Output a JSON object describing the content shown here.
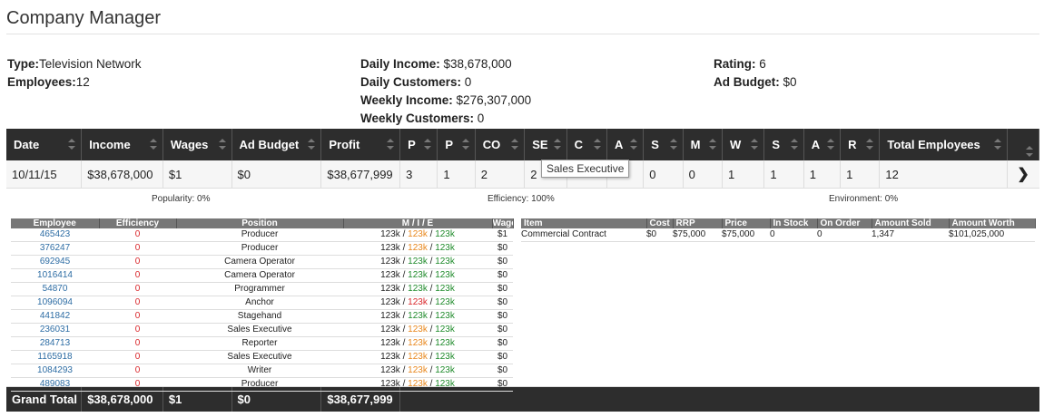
{
  "title": "Company Manager",
  "info": {
    "type_label": "Type:",
    "type_value": "Television Network",
    "employees_label": "Employees:",
    "employees_value": "12",
    "daily_income_label": "Daily Income:",
    "daily_income_value": " $38,678,000",
    "daily_customers_label": "Daily Customers:",
    "daily_customers_value": " 0",
    "weekly_income_label": "Weekly Income:",
    "weekly_income_value": " $276,307,000",
    "weekly_customers_label": "Weekly Customers:",
    "weekly_customers_value": " 0",
    "rating_label": "Rating:",
    "rating_value": " 6",
    "ad_budget_label": "Ad Budget:",
    "ad_budget_value": " $0"
  },
  "columns": [
    "Date",
    "Income",
    "Wages",
    "Ad Budget",
    "Profit",
    "P",
    "P",
    "CO",
    "SE",
    "C",
    "A",
    "S",
    "M",
    "W",
    "S",
    "A",
    "R",
    "Total Employees"
  ],
  "row": [
    "10/11/15",
    "$38,678,000",
    "$1",
    "$0",
    "$38,677,999",
    "3",
    "1",
    "2",
    "2",
    "",
    "",
    "0",
    "0",
    "1",
    "1",
    "1",
    "1",
    "12"
  ],
  "expand_icon": "chevron-right-icon",
  "tooltip": "Sales Executive",
  "metrics": {
    "popularity": "Popularity: 0%",
    "efficiency": "Efficiency: 100%",
    "environment": "Environment: 0%"
  },
  "employee_headers": [
    "Employee",
    "Efficiency",
    "Position",
    "M / I / E",
    "Wage"
  ],
  "employees": [
    {
      "id": "465423",
      "eff": "0",
      "pos": "Producer",
      "m": "123k",
      "i": "123k",
      "e": "123k",
      "i_color": "orange",
      "wage": "$1"
    },
    {
      "id": "376247",
      "eff": "0",
      "pos": "Producer",
      "m": "123k",
      "i": "123k",
      "e": "123k",
      "i_color": "orange",
      "wage": "$0"
    },
    {
      "id": "692945",
      "eff": "0",
      "pos": "Camera Operator",
      "m": "123k",
      "i": "123k",
      "e": "123k",
      "i_color": "green",
      "wage": "$0"
    },
    {
      "id": "1016414",
      "eff": "0",
      "pos": "Camera Operator",
      "m": "123k",
      "i": "123k",
      "e": "123k",
      "i_color": "green",
      "wage": "$0"
    },
    {
      "id": "54870",
      "eff": "0",
      "pos": "Programmer",
      "m": "123k",
      "i": "123k",
      "e": "123k",
      "i_color": "green",
      "wage": "$0"
    },
    {
      "id": "1096094",
      "eff": "0",
      "pos": "Anchor",
      "m": "123k",
      "i": "123k",
      "e": "123k",
      "i_color": "red",
      "wage": "$0"
    },
    {
      "id": "441842",
      "eff": "0",
      "pos": "Stagehand",
      "m": "123k",
      "i": "123k",
      "e": "123k",
      "i_color": "green",
      "wage": "$0"
    },
    {
      "id": "236031",
      "eff": "0",
      "pos": "Sales Executive",
      "m": "123k",
      "i": "123k",
      "e": "123k",
      "i_color": "orange",
      "wage": "$0"
    },
    {
      "id": "284713",
      "eff": "0",
      "pos": "Reporter",
      "m": "123k",
      "i": "123k",
      "e": "123k",
      "i_color": "orange",
      "wage": "$0"
    },
    {
      "id": "1165918",
      "eff": "0",
      "pos": "Sales Executive",
      "m": "123k",
      "i": "123k",
      "e": "123k",
      "i_color": "orange",
      "wage": "$0"
    },
    {
      "id": "1084293",
      "eff": "0",
      "pos": "Writer",
      "m": "123k",
      "i": "123k",
      "e": "123k",
      "i_color": "orange",
      "wage": "$0"
    },
    {
      "id": "489083",
      "eff": "0",
      "pos": "Producer",
      "m": "123k",
      "i": "123k",
      "e": "123k",
      "i_color": "orange",
      "wage": "$0"
    }
  ],
  "item_headers": [
    "Item",
    "Cost",
    "RRP",
    "Price",
    "In Stock",
    "On Order",
    "Amount Sold",
    "Amount Worth"
  ],
  "items": [
    [
      "Commercial Contract",
      "$0",
      "$75,000",
      "$75,000",
      "0",
      "0",
      "1,347",
      "$101,025,000"
    ]
  ],
  "totals": [
    "Grand Total",
    "$38,678,000",
    "$1",
    "$0",
    "$38,677,999"
  ]
}
